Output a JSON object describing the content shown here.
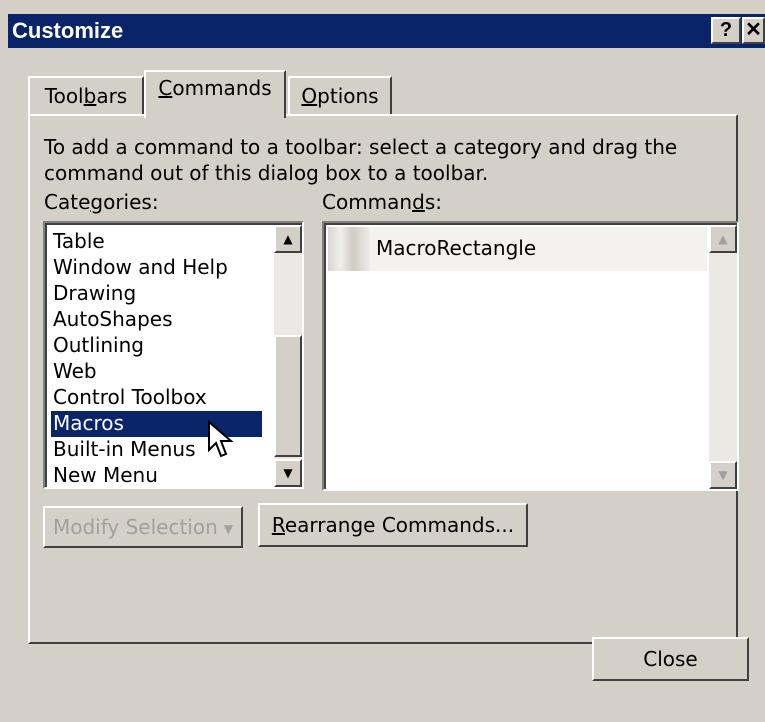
{
  "window": {
    "title": "Customize",
    "help_btn": "?",
    "close_btn": "✕"
  },
  "tabs": [
    {
      "label_pre": "Tool",
      "label_key": "b",
      "label_post": "ars",
      "active": false
    },
    {
      "label_pre": "",
      "label_key": "C",
      "label_post": "ommands",
      "active": true
    },
    {
      "label_pre": "",
      "label_key": "O",
      "label_post": "ptions",
      "active": false
    }
  ],
  "instructions": "To add a command to a toolbar: select a category and drag the command out of this dialog box to a toolbar.",
  "categories": {
    "label_pre": "Cate",
    "label_key": "g",
    "label_post": "ories:",
    "items": [
      "Table",
      "Window and Help",
      "Drawing",
      "AutoShapes",
      "Outlining",
      "Web",
      "Control Toolbox",
      "Macros",
      "Built-in Menus",
      "New Menu"
    ],
    "selected": "Macros"
  },
  "commands": {
    "label_pre": "Comman",
    "label_key": "d",
    "label_post": "s:",
    "items": [
      "MacroRectangle"
    ]
  },
  "buttons": {
    "modify_selection": "Modify Selection",
    "rearrange_pre": "",
    "rearrange_key": "R",
    "rearrange_post": "earrange Commands...",
    "close": "Close"
  },
  "icons": {
    "scroll_up": "triangle-up-icon",
    "scroll_down": "triangle-down-icon",
    "dropdown": "triangle-down-icon",
    "cursor": "arrow-cursor-icon"
  }
}
